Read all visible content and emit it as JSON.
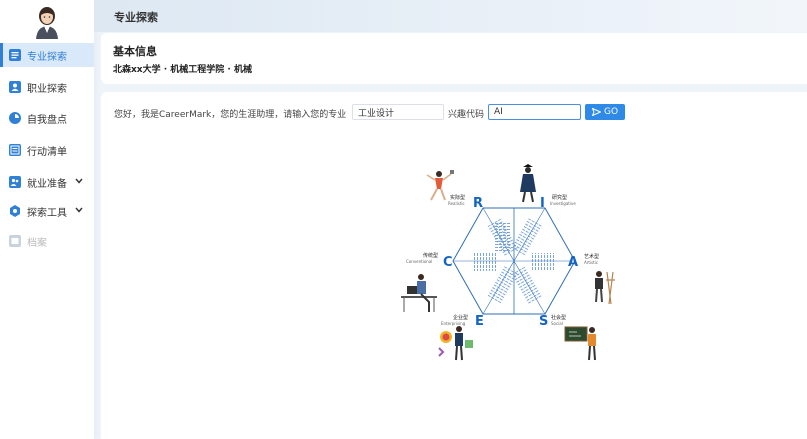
{
  "header": {
    "title": "专业探索"
  },
  "sidebar": {
    "items": [
      {
        "label": "专业探索",
        "icon": "grid-icon",
        "active": true
      },
      {
        "label": "职业探索",
        "icon": "person-icon"
      },
      {
        "label": "自我盘点",
        "icon": "chart-icon"
      },
      {
        "label": "行动清单",
        "icon": "list-icon"
      },
      {
        "label": "就业准备",
        "icon": "user-group-icon"
      },
      {
        "label": "探索工具",
        "icon": "gear-icon"
      },
      {
        "label": "档案",
        "icon": "folder-icon",
        "disabled": true
      }
    ]
  },
  "info": {
    "title": "基本信息",
    "subtitle": "北森xx大学 · 机械工程学院 · 机械"
  },
  "form": {
    "prompt": "您好，我是CareerMark，您的生涯助理，请输入您的专业",
    "major_value": "工业设计",
    "code_label": "兴趣代码",
    "code_value": "AI",
    "go_label": "GO"
  },
  "holland": {
    "types": [
      {
        "letter": "R",
        "cn": "实际型",
        "en": "Realistic"
      },
      {
        "letter": "I",
        "cn": "研究型",
        "en": "Investigative"
      },
      {
        "letter": "A",
        "cn": "艺术型",
        "en": "Artistic"
      },
      {
        "letter": "S",
        "cn": "社会型",
        "en": "Social"
      },
      {
        "letter": "E",
        "cn": "企业型",
        "en": "Enterprising"
      },
      {
        "letter": "C",
        "cn": "传统型",
        "en": "Conventional"
      }
    ]
  },
  "colors": {
    "accent": "#2f80d6",
    "active_bg": "#d9e9fa",
    "letter": "#1565c0"
  }
}
